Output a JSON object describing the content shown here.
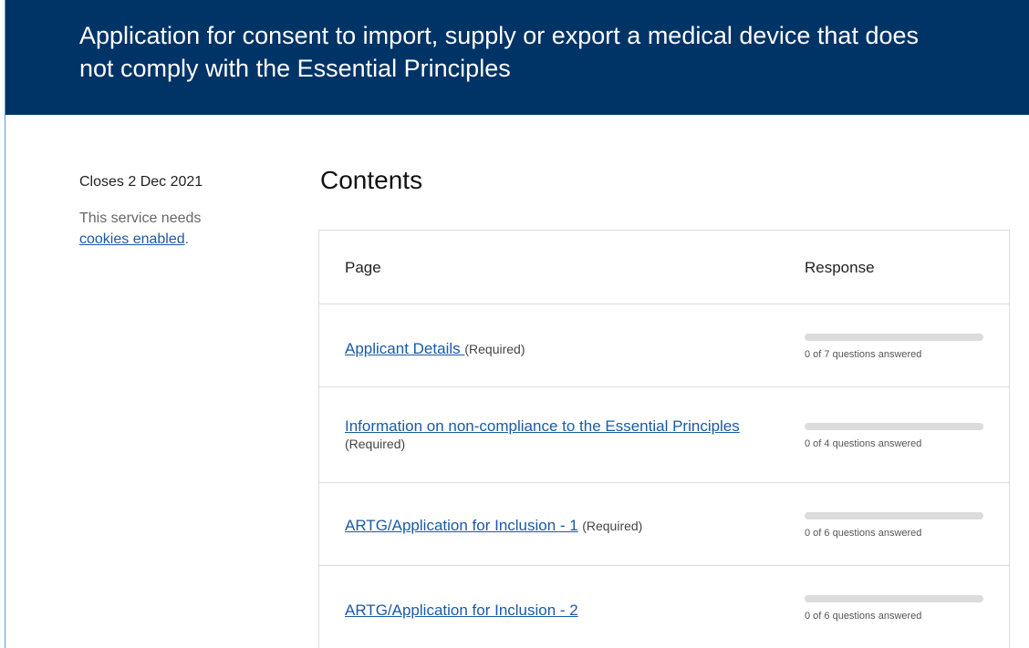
{
  "header": {
    "title": "Application for consent to import, supply or export a medical device that does not comply with the Essential Principles"
  },
  "sidebar": {
    "closes": "Closes 2 Dec 2021",
    "cookie_prefix": "This service needs",
    "cookie_link": "cookies enabled",
    "cookie_suffix": "."
  },
  "main": {
    "contents_title": "Contents",
    "table": {
      "col_page": "Page",
      "col_response": "Response",
      "rows": [
        {
          "link": "Applicant Details ",
          "required": "(Required)",
          "progress": 0,
          "response": "0 of 7 questions answered"
        },
        {
          "link": "Information on non-compliance to the Essential Principles",
          "required": "(Required)",
          "progress": 0,
          "response": "0 of 4 questions answered"
        },
        {
          "link": "ARTG/Application for Inclusion - 1",
          "required": "(Required)",
          "progress": 0,
          "response": "0 of 6 questions answered"
        },
        {
          "link": "ARTG/Application for Inclusion - 2",
          "required": "",
          "progress": 0,
          "response": "0 of 6 questions answered"
        }
      ]
    }
  },
  "colors": {
    "header_bg": "#003366",
    "link": "#1a5aa6",
    "border": "#dddddd",
    "progress_track": "#dcdcdc"
  }
}
